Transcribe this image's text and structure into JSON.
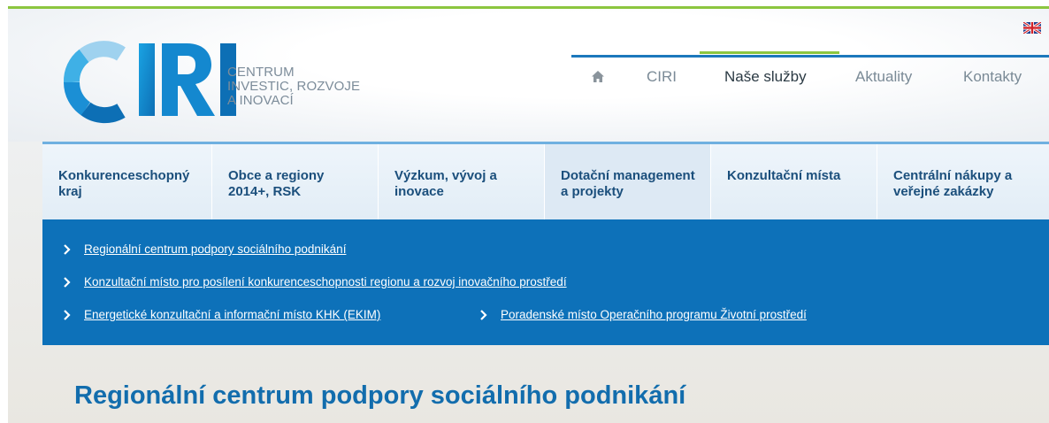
{
  "header": {
    "logo_letters": "CIRI",
    "logo_text": [
      "CENTRUM",
      "INVESTIC, ROZVOJE",
      "A INOVACÍ"
    ],
    "language_flag": "uk-flag-icon"
  },
  "nav": {
    "home_icon": "home-icon",
    "items": [
      {
        "label": "CIRI"
      },
      {
        "label": "Naše služby"
      },
      {
        "label": "Aktuality"
      },
      {
        "label": "Kontakty"
      }
    ],
    "active": "Naše služby"
  },
  "tabs": [
    {
      "label": "Konkurenceschopný kraj"
    },
    {
      "label": "Obce a regiony 2014+, RSK"
    },
    {
      "label": "Výzkum, vývoj a inovace"
    },
    {
      "label": "Dotační management a projekty"
    },
    {
      "label": "Konzultační místa"
    },
    {
      "label": "Centrální nákupy a veřejné zakázky"
    }
  ],
  "submenu": {
    "links": [
      {
        "label": "Regionální centrum podpory sociálního podnikání"
      },
      {
        "label": "Konzultační místo pro posílení konkurenceschopnosti regionu a rozvoj inovačního prostředí"
      },
      {
        "label": "Energetické konzultační a informační místo KHK (EKIM)"
      },
      {
        "label": "Poradenské místo Operačního programu Životní prostředí"
      }
    ]
  },
  "main": {
    "title": "Regionální centrum podpory sociálního podnikání"
  },
  "colors": {
    "accent_green": "#8cc63f",
    "brand_blue": "#0d71b9",
    "title_blue": "#126dad"
  }
}
